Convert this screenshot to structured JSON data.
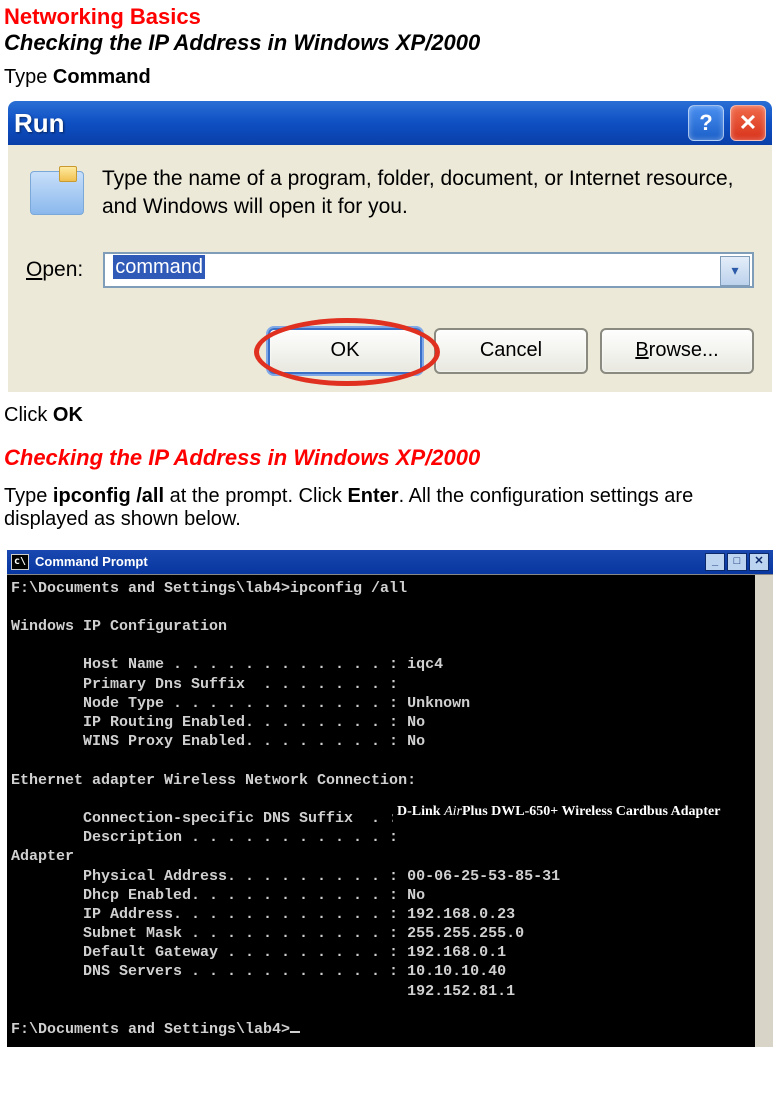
{
  "heading": {
    "title": "Networking Basics",
    "subtitle": "Checking the IP Address in Windows XP/2000"
  },
  "step1": {
    "prefix": "Type ",
    "bold": "Command"
  },
  "run_dialog": {
    "title": "Run",
    "help_glyph": "?",
    "close_glyph": "✕",
    "description": "Type the name of a program, folder, document, or Internet resource, and Windows will open it for you.",
    "open_label": "Open:",
    "open_value": "command",
    "dropdown_glyph": "▾",
    "buttons": {
      "ok": "OK",
      "cancel": "Cancel",
      "browse_prefix": "B",
      "browse_rest": "rowse..."
    }
  },
  "step2": {
    "prefix": "Click ",
    "bold": "OK"
  },
  "subheading2": "Checking the IP Address in Windows XP/2000",
  "step3": {
    "p1": "Type ",
    "b1": "ipconfig /all",
    "p2": " at the prompt.  Click ",
    "b2": "Enter",
    "p3": ".  All the configuration settings are displayed as shown below."
  },
  "cmd": {
    "title": "Command Prompt",
    "icon_text": "c\\",
    "min": "_",
    "max": "□",
    "close": "✕",
    "line1": "F:\\Documents and Settings\\lab4>ipconfig /all",
    "line2": "Windows IP Configuration",
    "host": "        Host Name . . . . . . . . . . . . : iqc4",
    "dns": "        Primary Dns Suffix  . . . . . . . :",
    "node": "        Node Type . . . . . . . . . . . . : Unknown",
    "iprout": "        IP Routing Enabled. . . . . . . . : No",
    "wins": "        WINS Proxy Enabled. . . . . . . . : No",
    "eth": "Ethernet adapter Wireless Network Connection:",
    "csuf": "        Connection-specific DNS Suffix  . :",
    "desc": "        Description . . . . . . . . . . . :",
    "adapter": "Adapter",
    "phys": "        Physical Address. . . . . . . . . : 00-06-25-53-85-31",
    "dhcp": "        Dhcp Enabled. . . . . . . . . . . : No",
    "ip": "        IP Address. . . . . . . . . . . . : 192.168.0.23",
    "mask": "        Subnet Mask . . . . . . . . . . . : 255.255.255.0",
    "gw": "        Default Gateway . . . . . . . . . : 192.168.0.1",
    "dnss": "        DNS Servers . . . . . . . . . . . : 10.10.10.40",
    "dnss2": "                                            192.152.81.1",
    "prompt2": "F:\\Documents and Settings\\lab4>",
    "overlay_brand": "D-Link ",
    "overlay_air": "Air",
    "overlay_rest": "Plus DWL-650+ Wireless Cardbus Adapter"
  }
}
